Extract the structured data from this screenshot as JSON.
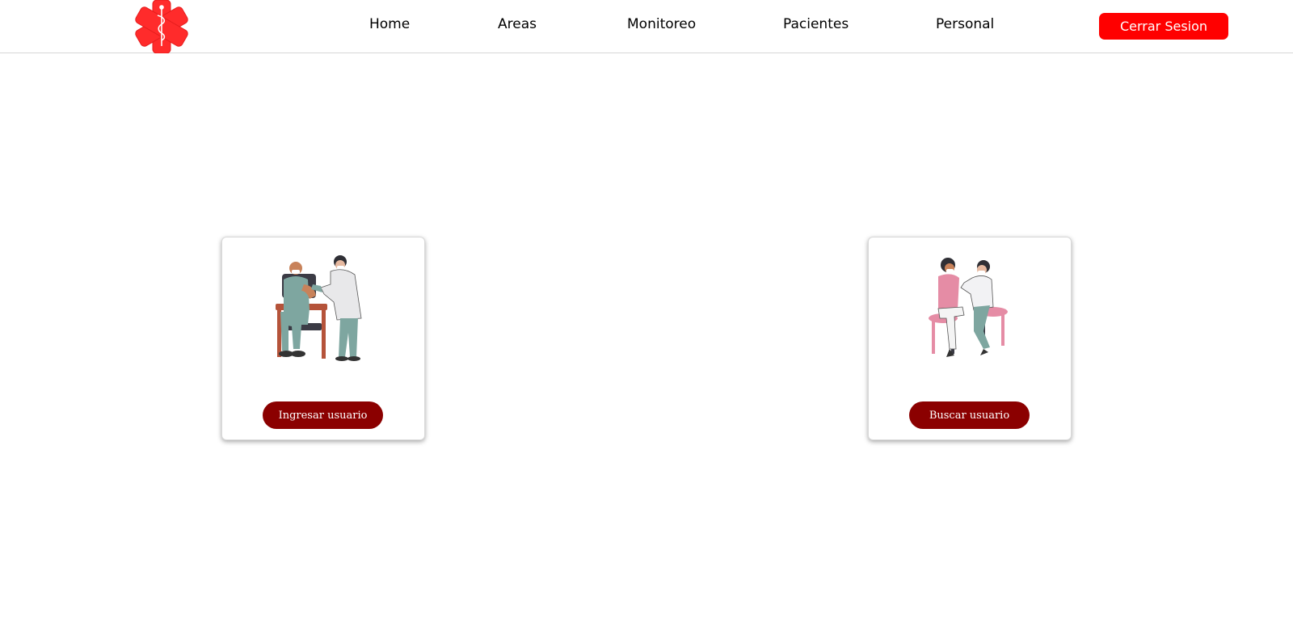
{
  "nav": {
    "logo_icon": "medical-star-of-life-icon",
    "items": [
      {
        "label": "Home"
      },
      {
        "label": "Areas"
      },
      {
        "label": "Monitoreo"
      },
      {
        "label": "Pacientes"
      },
      {
        "label": "Personal"
      }
    ],
    "logout_label": "Cerrar Sesion"
  },
  "cards": [
    {
      "illustration": "vaccination-seated-patient-illustration",
      "button_label": "Ingresar usuario"
    },
    {
      "illustration": "vaccination-stool-patient-illustration",
      "button_label": "Buscar usuario"
    }
  ],
  "colors": {
    "accent_red": "#ff0000",
    "button_dark_red": "#8b0000",
    "logo_red": "#ff2b2b"
  }
}
